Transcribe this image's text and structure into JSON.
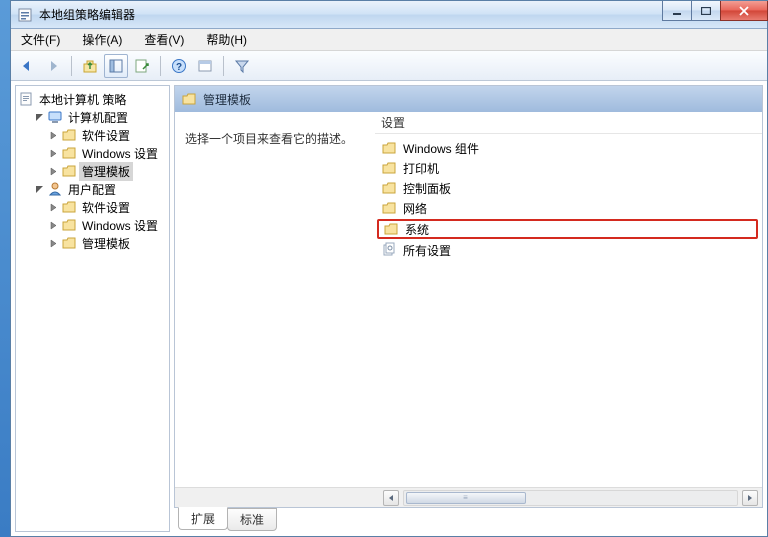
{
  "window": {
    "title": "本地组策略编辑器"
  },
  "menu": {
    "file": "文件(F)",
    "action": "操作(A)",
    "view": "查看(V)",
    "help": "帮助(H)"
  },
  "tree": {
    "root": "本地计算机 策略",
    "computer": "计算机配置",
    "user": "用户配置",
    "software": "软件设置",
    "windows": "Windows 设置",
    "admin": "管理模板"
  },
  "detail": {
    "header": "管理模板",
    "desc": "选择一个项目来查看它的描述。",
    "col_setting": "设置",
    "items": [
      "Windows 组件",
      "打印机",
      "控制面板",
      "网络",
      "系统",
      "所有设置"
    ]
  },
  "tabs": {
    "extended": "扩展",
    "standard": "标准"
  }
}
